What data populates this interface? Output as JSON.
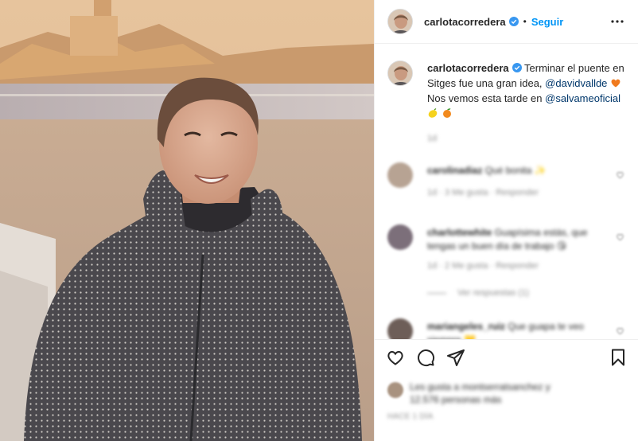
{
  "post": {
    "photo_alt": "Carlota Corredera smiling on a beach at sunset in Sitges",
    "author": {
      "username": "carlotacorredera",
      "verified": true
    },
    "header": {
      "separator": "•",
      "follow_label": "Seguir"
    },
    "caption": {
      "text_before": "Terminar el puente en Sitges fue una gran idea, ",
      "mention_1": "@davidvallde",
      "text_middle": " Nos vemos esta tarde en ",
      "mention_2": "@salvameoficial",
      "emojis": [
        "heart-orange",
        "lemon",
        "tangerine"
      ],
      "meta": "1d"
    },
    "comments": [
      {
        "username": "carolinadiaz",
        "text": "Qué bonita ✨",
        "meta": "1d · 3 Me gusta · Responder"
      },
      {
        "username": "charlottewhite",
        "text": "Guapísima estás, que tengas un buen día de trabajo 😘",
        "meta": "1d · 2 Me gusta · Responder",
        "replies": "Ver respuestas (1)"
      },
      {
        "username": "mariangeles_ruiz",
        "text": "Que guapa te veo siempre 💛",
        "meta": ""
      }
    ],
    "likes": {
      "text": "Les gusta a montserratsanchez y 12.576 personas más"
    },
    "timestamp": "HACE 1 DÍA"
  },
  "colors": {
    "accent": "#0095f6",
    "mention": "#00376b",
    "verified": "#3897f0",
    "text": "#262626",
    "muted": "#8e8e8e",
    "border": "#efefef"
  },
  "icons": [
    "verified-badge-icon",
    "more-options-icon",
    "heart-icon",
    "comment-icon",
    "share-icon",
    "bookmark-icon"
  ]
}
